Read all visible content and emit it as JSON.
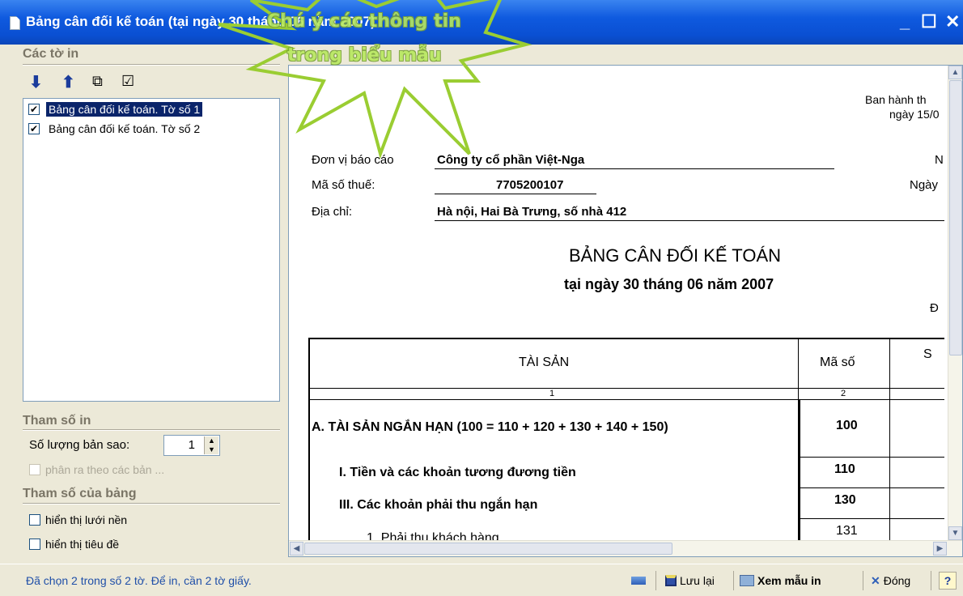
{
  "window": {
    "title": "Bảng cân đối kế toán (tại ngày 30 tháng 06 năm 2007)",
    "minimize": "_",
    "maximize": "☐",
    "close": "✕"
  },
  "callout": {
    "line1": "Chú ý các thông tin",
    "line2": "trong biểu mẫu",
    "color": "#9acd32"
  },
  "sheets_section": {
    "header": "Các tờ in",
    "toolbar": [
      "arrow-down-icon",
      "arrow-up-icon",
      "uncheck-all-icon",
      "check-all-icon"
    ],
    "items": [
      {
        "label": "Bảng cân đối kế toán. Tờ số 1",
        "checked": true,
        "selected": true
      },
      {
        "label": "Bảng cân đối kế toán. Tờ số 2",
        "checked": true,
        "selected": false
      }
    ]
  },
  "print_params": {
    "header": "Tham số in",
    "copies_label": "Số lượng bản sao:",
    "copies_value": "1",
    "split_label": "phân ra theo các bản ...",
    "split_checked": false
  },
  "table_params": {
    "header": "Tham số của bảng",
    "grid_label": "hiển thị lưới nền",
    "grid_checked": false,
    "header_label": "hiển thị tiêu đề",
    "header_checked": false
  },
  "report": {
    "issued_line1": "Ban hành th",
    "issued_line2": "ngày 15/0",
    "unit_label": "Đơn vị báo cáo",
    "unit_value": "Công ty cổ phần Việt-Nga",
    "tax_label": "Mã số thuế:",
    "tax_value": "7705200107",
    "addr_label": "Địa chỉ:",
    "addr_value": "Hà nội, Hai Bà Trưng, số nhà 412",
    "right_n": "N",
    "right_date": "Ngày",
    "title": "BẢNG CÂN ĐỐI KẾ TOÁN",
    "subtitle": "tại ngày 30 tháng 06 năm 2007",
    "unit_mark": "Đ",
    "col_asset": "TÀI SẢN",
    "col_code": "Mã số",
    "col_3": "S",
    "idx_1": "1",
    "idx_2": "2",
    "rows": [
      {
        "label": "A. TÀI SẢN NGẮN HẠN (100 = 110 + 120 + 130 + 140 + 150)",
        "code": "100"
      },
      {
        "label": "I. Tiền và các khoản tương đương tiền",
        "code": "110"
      },
      {
        "label": "III. Các khoản phải thu ngắn hạn",
        "code": "130"
      },
      {
        "label": "1. Phải thu khách hàng",
        "code": "131"
      }
    ]
  },
  "status": {
    "text": "Đã chọn 2 trong số 2  tờ. Để in, cần 2  tờ giấy.",
    "save": "Lưu lại",
    "preview": "Xem mẫu in",
    "close": "Đóng",
    "help": "?"
  }
}
